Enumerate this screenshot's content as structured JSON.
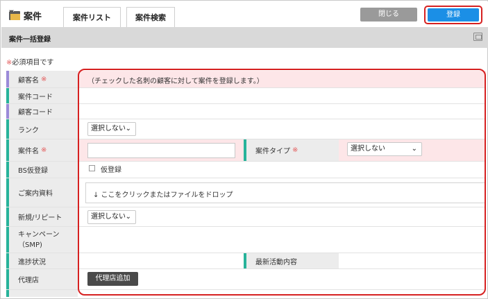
{
  "header": {
    "app_title": "案件",
    "tabs": [
      {
        "label": "案件リスト"
      },
      {
        "label": "案件検索"
      }
    ],
    "close_label": "閉じる",
    "register_label": "登録"
  },
  "section": {
    "title": "案件一括登録"
  },
  "required_note": {
    "mark": "※",
    "text": "必須項目です"
  },
  "form": {
    "customer_name": {
      "label": "顧客名",
      "required": "※",
      "value": "（チェックした名刺の顧客に対して案件を登録します。）"
    },
    "case_code": {
      "label": "案件コード"
    },
    "customer_code": {
      "label": "顧客コード"
    },
    "rank": {
      "label": "ランク",
      "selected": "選択しない"
    },
    "case_name": {
      "label": "案件名",
      "required": "※",
      "value": ""
    },
    "case_type": {
      "label": "案件タイプ",
      "required": "※",
      "selected": "選択しない"
    },
    "bs_provisional": {
      "label": "BS仮登録",
      "checkbox_label": "仮登録"
    },
    "guide_material": {
      "label": "ご案内資料",
      "dropzone_text": "↓ ここをクリックまたはファイルをドロップ"
    },
    "new_repeat": {
      "label": "新規/リピート",
      "selected": "選択しない"
    },
    "campaign": {
      "label": "キャンペーン（SMP)"
    },
    "progress": {
      "label": "進捗状況"
    },
    "latest_activity": {
      "label": "最新活動内容"
    },
    "agency": {
      "label": "代理店",
      "button_label": "代理店追加"
    }
  },
  "colors": {
    "accent_teal": "#27b39a",
    "accent_purple": "#9b8ad8",
    "required_red": "#e35a5a",
    "register_blue": "#1b8fe6",
    "highlight_red": "#d62020"
  }
}
